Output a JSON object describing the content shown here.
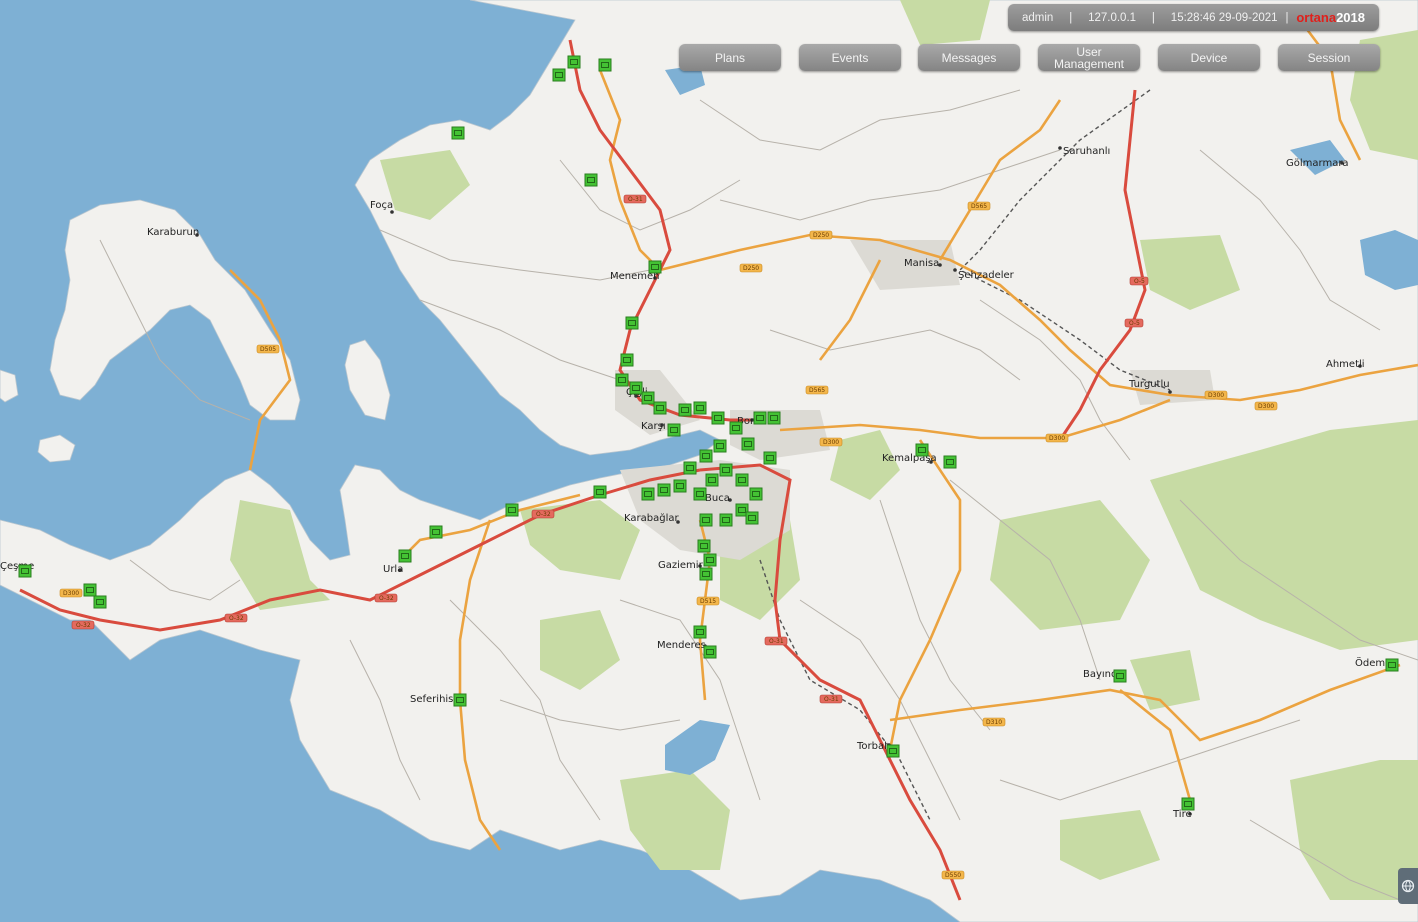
{
  "header": {
    "user": "admin",
    "ip": "127.0.0.1",
    "datetime": "15:28:46 29-09-2021",
    "brand": "ortana",
    "brand_year": "2018",
    "brand_color": "#e0201c"
  },
  "nav": {
    "plans": "Plans",
    "events": "Events",
    "messages": "Messages",
    "user_management": "User Management",
    "device": "Device",
    "session": "Session"
  },
  "map": {
    "places": {
      "karaburun": "Karaburun",
      "foca": "Foça",
      "menemen": "Menemen",
      "manisa": "Manisa",
      "sehzadeler": "Şehzadeler",
      "saruhanli": "Saruhanlı",
      "golmarmara": "Gölmarmara",
      "ahmetli": "Ahmetli",
      "turgutlu": "Turgutlu",
      "cigli": "Çiğli",
      "karsiyaka": "Karşı",
      "bornova": "Bor",
      "kemalpasa": "Kemalpaşa",
      "buca": "Buca",
      "karabaglar": "Karabağlar",
      "gaziemir": "Gaziemir",
      "menderes": "Menderes",
      "urla": "Urla",
      "cesme": "Çeşme",
      "seferihisar": "Seferihisar",
      "torbali": "Torbalı",
      "bayindir": "Bayındır",
      "odemis": "Ödemiş",
      "tire": "Tire"
    },
    "roads": {
      "o32": "O-32",
      "o31": "O-31",
      "o5": "O-5",
      "d300": "D300",
      "d550": "D550",
      "d565": "D565",
      "d250": "D250",
      "d310": "D310",
      "d505": "D505",
      "d515": "D515"
    },
    "colors": {
      "sea": "#7eb0d4",
      "land": "#f2f1ee",
      "forest": "#c7dba4",
      "motorway": "#d94b3e",
      "primary": "#eba340",
      "device_marker": "#44c234"
    },
    "device_marker_icon": "camera-device-icon",
    "corner_icon": "globe-icon"
  }
}
